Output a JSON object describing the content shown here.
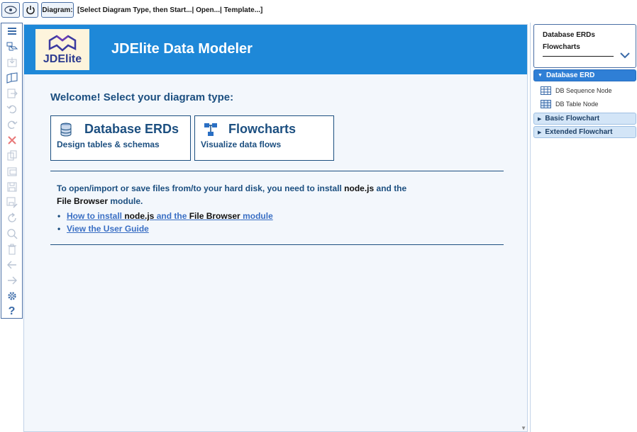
{
  "toolbar": {
    "diagram_label": "Diagram:",
    "status_text": "[Select Diagram Type, then Start...| Open...| Template...]",
    "icon1": "eye-icon",
    "icon2": "power-icon"
  },
  "left_tools": [
    {
      "name": "menu-icon",
      "state": "active"
    },
    {
      "name": "new-diagram-icon",
      "state": "active"
    },
    {
      "name": "import-icon",
      "state": "disabled"
    },
    {
      "name": "open-book-icon",
      "state": "active"
    },
    {
      "name": "export-icon",
      "state": "disabled"
    },
    {
      "name": "undo-icon",
      "state": "disabled"
    },
    {
      "name": "redo-icon",
      "state": "disabled"
    },
    {
      "name": "delete-icon",
      "state": "disabled-red"
    },
    {
      "name": "copy-icon",
      "state": "disabled"
    },
    {
      "name": "paste-icon",
      "state": "disabled"
    },
    {
      "name": "save-icon",
      "state": "disabled"
    },
    {
      "name": "save-as-icon",
      "state": "disabled"
    },
    {
      "name": "refresh-icon",
      "state": "disabled"
    },
    {
      "name": "search-icon",
      "state": "disabled"
    },
    {
      "name": "trash-icon",
      "state": "disabled"
    },
    {
      "name": "arrow-left-icon",
      "state": "disabled"
    },
    {
      "name": "arrow-right-icon",
      "state": "disabled"
    },
    {
      "name": "gear-icon",
      "state": "active"
    },
    {
      "name": "help-icon",
      "state": "active"
    }
  ],
  "header": {
    "logo_text": "JDElite",
    "title": "JDElite Data Modeler"
  },
  "main": {
    "welcome": "Welcome! Select your diagram type:",
    "cards": [
      {
        "title": "Database ERDs",
        "subtitle": "Design tables & schemas"
      },
      {
        "title": "Flowcharts",
        "subtitle": "Visualize data flows"
      }
    ],
    "info_part1": "To open/import or save files from/to your hard disk, you need to install ",
    "info_nodejs": "node.js",
    "info_part2": " and the ",
    "info_filebrowser": "File Browser",
    "info_part3": " module.",
    "link1_part1": "How to install ",
    "link1_nodejs": "node.js",
    "link1_part2": " and the ",
    "link1_filebrowser": "File Browser",
    "link1_part3": " module",
    "link2": "View the User Guide"
  },
  "right_panel": {
    "select_line1": "Database ERDs",
    "select_line2": "Flowcharts",
    "accordion": [
      {
        "label": "Database ERD",
        "open": true,
        "items": [
          {
            "label": "DB Sequence Node"
          },
          {
            "label": "DB Table Node"
          }
        ]
      },
      {
        "label": "Basic Flowchart",
        "open": false
      },
      {
        "label": "Extended Flowchart",
        "open": false
      }
    ]
  },
  "colors": {
    "header_blue": "#1e88d8",
    "text_navy": "#1c4f80",
    "link_blue": "#3a6fc4",
    "accordion_active": "#2f7fd6",
    "accordion_idle": "#d3e5f7"
  }
}
